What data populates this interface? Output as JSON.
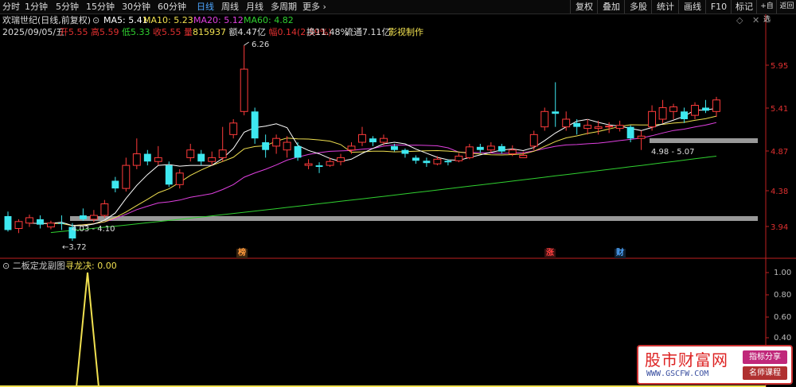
{
  "toolbar": {
    "periods": [
      "分时",
      "1分钟",
      "5分钟",
      "15分钟",
      "30分钟",
      "60分钟",
      "日线",
      "周线",
      "月线",
      "多周期",
      "更多"
    ],
    "active_period": "日线",
    "right_buttons": [
      "复权",
      "叠加",
      "多股",
      "统计",
      "画线",
      "F10",
      "标记",
      "+自选",
      "返回"
    ]
  },
  "header": {
    "title": "欢瑞世纪(日线,前复权)",
    "ma": [
      {
        "label": "MA5: 5.41",
        "color": "#ffffff"
      },
      {
        "label": "MA10: 5.23",
        "color": "#f0e050"
      },
      {
        "label": "MA20: 5.12",
        "color": "#e040e0"
      },
      {
        "label": "MA60: 4.82",
        "color": "#30d030"
      }
    ],
    "date": "2025/09/05/五",
    "open_label": "开",
    "open": "5.55",
    "high_label": "高",
    "high": "5.59",
    "low_label": "低",
    "low": "5.33",
    "close_label": "收",
    "close": "5.55",
    "vol_label": "量",
    "vol": "815937",
    "amount_label": "额",
    "amount": "4.47亿",
    "change_label": "幅",
    "change": "0.14(2.59%)",
    "turnover": "换11.48%",
    "float": "流通7.11亿",
    "producer": "影视制作"
  },
  "price_axis": [
    "5.95",
    "5.41",
    "4.87",
    "4.38",
    "3.94"
  ],
  "annotations": {
    "high_price": "6.26",
    "low_price": "3.72",
    "band_low": "4.03 - 4.10",
    "band_high": "4.98 - 5.07"
  },
  "markers": [
    {
      "text": "榜",
      "color": "#ff9a3c"
    },
    {
      "text": "涨",
      "color": "#ff4040"
    },
    {
      "text": "财",
      "color": "#4da6ff"
    }
  ],
  "sub_panel": {
    "title": "二板定龙副图",
    "indicator": "寻龙决: 0.00",
    "axis": [
      "1.00",
      "0.80",
      "0.60",
      "0.40"
    ]
  },
  "watermark": {
    "brand": "股市财富网",
    "url": "WWW.GSCFW.COM",
    "tag1": "指标分享",
    "tag2": "名师课程"
  },
  "chart_data": {
    "type": "candlestick",
    "y_range": [
      3.72,
      6.26
    ],
    "candles": [
      [
        4.04,
        3.86,
        4.1,
        3.84
      ],
      [
        3.88,
        3.97,
        4.0,
        3.82
      ],
      [
        3.95,
        4.02,
        4.06,
        3.9
      ],
      [
        4.0,
        3.93,
        4.05,
        3.88
      ],
      [
        3.9,
        3.95,
        3.98,
        3.87
      ],
      [
        3.95,
        3.94,
        4.05,
        3.86
      ],
      [
        3.9,
        3.75,
        3.95,
        3.72
      ],
      [
        4.05,
        4.0,
        4.14,
        3.98
      ],
      [
        4.0,
        4.05,
        4.12,
        3.96
      ],
      [
        4.05,
        4.2,
        4.25,
        4.02
      ],
      [
        4.5,
        4.4,
        4.55,
        4.35
      ],
      [
        4.4,
        4.7,
        4.8,
        4.36
      ],
      [
        4.7,
        4.85,
        5.05,
        4.65
      ],
      [
        4.85,
        4.75,
        4.9,
        4.7
      ],
      [
        4.75,
        4.8,
        4.95,
        4.7
      ],
      [
        4.7,
        4.45,
        4.75,
        4.42
      ],
      [
        4.45,
        4.6,
        4.65,
        4.4
      ],
      [
        4.8,
        4.9,
        4.98,
        4.75
      ],
      [
        4.85,
        4.75,
        4.9,
        4.7
      ],
      [
        4.75,
        4.8,
        4.88,
        4.7
      ],
      [
        4.8,
        4.9,
        5.2,
        4.75
      ],
      [
        5.1,
        5.25,
        5.3,
        5.05
      ],
      [
        5.4,
        5.95,
        6.26,
        5.35
      ],
      [
        5.4,
        5.05,
        5.45,
        4.98
      ],
      [
        5.0,
        4.9,
        5.1,
        4.8
      ],
      [
        4.95,
        5.05,
        5.1,
        4.85
      ],
      [
        4.9,
        5.0,
        5.08,
        4.8
      ],
      [
        4.95,
        4.8,
        5.0,
        4.76
      ],
      [
        4.7,
        4.72,
        4.78,
        4.65
      ],
      [
        4.7,
        4.68,
        4.74,
        4.6
      ],
      [
        4.7,
        4.75,
        4.8,
        4.68
      ],
      [
        4.75,
        4.8,
        4.85,
        4.7
      ],
      [
        4.9,
        4.95,
        5.0,
        4.85
      ],
      [
        5.0,
        5.1,
        5.2,
        4.95
      ],
      [
        5.05,
        5.0,
        5.08,
        4.95
      ],
      [
        5.0,
        5.05,
        5.1,
        4.96
      ],
      [
        4.95,
        4.9,
        4.98,
        4.88
      ],
      [
        4.9,
        4.85,
        4.92,
        4.8
      ],
      [
        4.8,
        4.76,
        4.83,
        4.72
      ],
      [
        4.76,
        4.73,
        4.8,
        4.68
      ],
      [
        4.72,
        4.78,
        4.82,
        4.7
      ],
      [
        4.76,
        4.74,
        4.78,
        4.7
      ],
      [
        4.76,
        4.82,
        4.86,
        4.74
      ],
      [
        4.8,
        4.94,
        4.98,
        4.78
      ],
      [
        4.94,
        4.9,
        4.98,
        4.86
      ],
      [
        4.9,
        4.95,
        5.0,
        4.86
      ],
      [
        4.95,
        4.88,
        4.98,
        4.85
      ],
      [
        4.85,
        4.9,
        4.96,
        4.82
      ],
      [
        4.8,
        4.83,
        4.88,
        4.8
      ],
      [
        4.95,
        5.1,
        5.15,
        4.9
      ],
      [
        5.2,
        5.4,
        5.45,
        5.15
      ],
      [
        5.4,
        5.37,
        5.78,
        5.2
      ],
      [
        5.2,
        5.3,
        5.4,
        5.15
      ],
      [
        5.25,
        5.2,
        5.3,
        5.1
      ],
      [
        5.18,
        5.22,
        5.3,
        5.1
      ],
      [
        5.18,
        5.2,
        5.28,
        5.1
      ],
      [
        5.2,
        5.21,
        5.26,
        5.12
      ],
      [
        5.18,
        5.22,
        5.28,
        5.14
      ],
      [
        5.2,
        5.05,
        5.22,
        5.0
      ],
      [
        5.05,
        5.08,
        5.15,
        4.9
      ],
      [
        5.2,
        5.4,
        5.48,
        5.15
      ],
      [
        5.3,
        5.45,
        5.55,
        5.25
      ],
      [
        5.4,
        5.46,
        5.5,
        5.3
      ],
      [
        5.4,
        5.3,
        5.45,
        5.25
      ],
      [
        5.35,
        5.48,
        5.52,
        5.3
      ],
      [
        5.45,
        5.41,
        5.55,
        5.38
      ],
      [
        5.4,
        5.55,
        5.59,
        5.33
      ]
    ],
    "ma5_points": 67,
    "sub_series": [
      0,
      0,
      0,
      0,
      0,
      0,
      0,
      1,
      0,
      0,
      0,
      0,
      0,
      0,
      0,
      0,
      0,
      0,
      0,
      0,
      0,
      0,
      0,
      0,
      0,
      0,
      0,
      0,
      0,
      0,
      0,
      0,
      0,
      0,
      0,
      0,
      0,
      0,
      0,
      0,
      0,
      0,
      0,
      0,
      0,
      0,
      0,
      0,
      0,
      0,
      0,
      0,
      0,
      0,
      0,
      0,
      0,
      0,
      0,
      0,
      0,
      0,
      0,
      0,
      0,
      0,
      0
    ]
  }
}
